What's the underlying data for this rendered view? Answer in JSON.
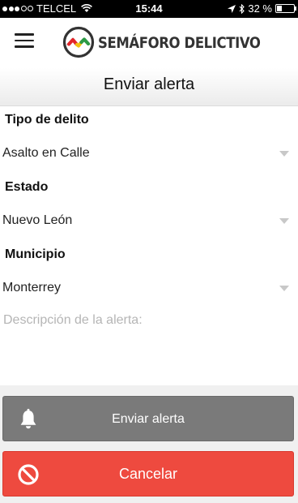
{
  "status_bar": {
    "carrier": "TELCEL",
    "time": "15:44",
    "battery": "32 %",
    "battery_level": 0.32,
    "signal_bars_filled": 3,
    "signal_bars_total": 5
  },
  "app": {
    "title": "SEMÁFORO DELICTIVO",
    "logo_colors": [
      "#e3262a",
      "#f2c10f",
      "#2c9a45",
      "#333333"
    ]
  },
  "page": {
    "title": "Enviar alerta"
  },
  "form": {
    "crime_type": {
      "label": "Tipo de delito",
      "value": "Asalto en Calle"
    },
    "state": {
      "label": "Estado",
      "value": "Nuevo León"
    },
    "municipality": {
      "label": "Municipio",
      "value": "Monterrey"
    },
    "description": {
      "placeholder": "Descripción de la alerta:",
      "value": ""
    }
  },
  "buttons": {
    "send": {
      "label": "Enviar alerta",
      "icon": "bell-icon",
      "color": "#7a7a7a"
    },
    "cancel": {
      "label": "Cancelar",
      "icon": "prohibited-icon",
      "color": "#ee4a3f"
    }
  }
}
